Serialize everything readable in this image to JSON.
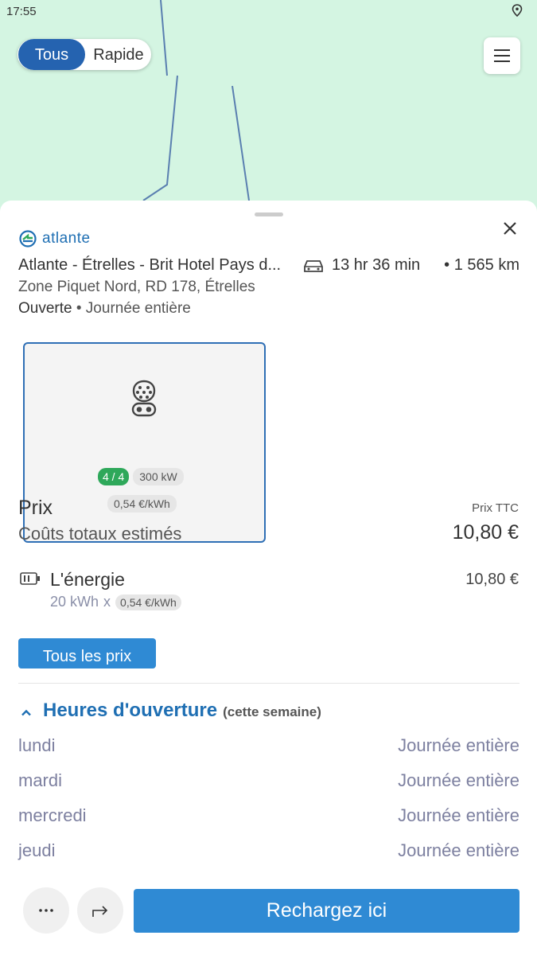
{
  "status_bar": {
    "time": "17:55"
  },
  "filter": {
    "all_label": "Tous",
    "fast_label": "Rapide"
  },
  "station": {
    "brand": "atlante",
    "name": "Atlante - Étrelles - Brit Hotel Pays d...",
    "duration": "13 hr 36 min",
    "distance": "• 1 565 km",
    "address": "Zone Piquet Nord, RD 178, Étrelles",
    "status": "Ouverte",
    "status_detail": "• Journée entière"
  },
  "connector": {
    "availability": "4 / 4",
    "power": "300 kW",
    "rate": "0,54 €/kWh"
  },
  "pricing": {
    "title": "Prix",
    "tax_note": "Prix TTC",
    "estimated_label": "Coûts totaux estimés",
    "estimated_value": "10,80 €",
    "energy_label": "L'énergie",
    "energy_value": "10,80 €",
    "energy_qty": "20 kWh",
    "energy_x": "x",
    "energy_rate": "0,54 €/kWh",
    "all_prices_button": "Tous les prix"
  },
  "opening_hours": {
    "title": "Heures d'ouverture",
    "subtitle": "(cette semaine)",
    "days": [
      {
        "day": "lundi",
        "hours": "Journée entière"
      },
      {
        "day": "mardi",
        "hours": "Journée entière"
      },
      {
        "day": "mercredi",
        "hours": "Journée entière"
      },
      {
        "day": "jeudi",
        "hours": "Journée entière"
      }
    ]
  },
  "actions": {
    "charge_button": "Rechargez ici"
  },
  "colors": {
    "primary": "#2f8ad4",
    "brand_blue": "#1f6fb3",
    "available_green": "#2ea85a",
    "map_green": "#d4f5e2"
  },
  "icons": [
    "location-icon",
    "menu-icon",
    "atlante-logo-icon",
    "close-icon",
    "car-icon",
    "plug-icon",
    "battery-icon",
    "chevron-up-icon",
    "more-icon",
    "share-icon"
  ]
}
